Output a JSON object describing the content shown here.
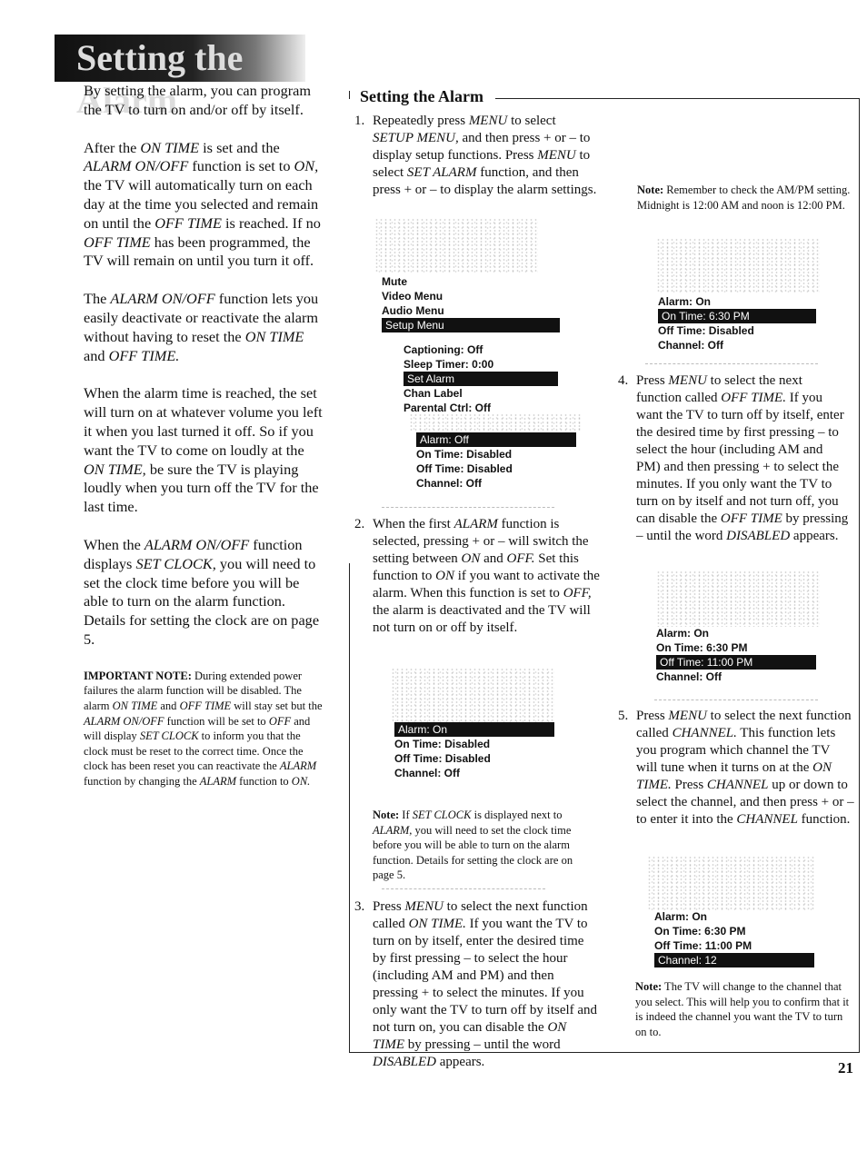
{
  "page_title": "Setting the Alarm",
  "left_column": [
    [
      {
        "t": "By setting the alarm, you can program the TV to turn on and/or off by itself."
      }
    ],
    [
      {
        "t": "After the "
      },
      {
        "t": "ON TIME",
        "i": true
      },
      {
        "t": " is set and the "
      },
      {
        "t": "ALARM ON/OFF",
        "i": true
      },
      {
        "t": " function is set to "
      },
      {
        "t": "ON,",
        "i": true
      },
      {
        "t": " the TV will automatically turn on each day at the time you selected and remain on until the "
      },
      {
        "t": "OFF TIME",
        "i": true
      },
      {
        "t": " is reached.  If no "
      },
      {
        "t": "OFF TIME",
        "i": true
      },
      {
        "t": " has been programmed, the TV will remain on until you turn it off."
      }
    ],
    [
      {
        "t": "The "
      },
      {
        "t": "ALARM ON/OFF",
        "i": true
      },
      {
        "t": " function lets you easily deactivate or reactivate the alarm without having to reset the "
      },
      {
        "t": "ON TIME",
        "i": true
      },
      {
        "t": " and "
      },
      {
        "t": "OFF TIME.",
        "i": true
      }
    ],
    [
      {
        "t": "When the alarm time is reached, the set will turn on at whatever volume you left it when you last turned it off.  So if you want the TV to come on loudly at the "
      },
      {
        "t": "ON TIME,",
        "i": true
      },
      {
        "t": " be sure the TV is playing loudly when you turn off the TV for the last time."
      }
    ],
    [
      {
        "t": "When the "
      },
      {
        "t": "ALARM ON/OFF",
        "i": true
      },
      {
        "t": " function displays "
      },
      {
        "t": "SET CLOCK,",
        "i": true
      },
      {
        "t": " you will need to set the clock time before you will be able to turn on the alarm function. Details for setting the clock are on page 5."
      }
    ]
  ],
  "important_note": [
    {
      "t": "IMPORTANT NOTE:",
      "b": true
    },
    {
      "t": " During extended power failures the alarm function will be disabled.  The alarm "
    },
    {
      "t": "ON TIME",
      "i": true
    },
    {
      "t": " and "
    },
    {
      "t": "OFF TIME",
      "i": true
    },
    {
      "t": " will stay set but the "
    },
    {
      "t": "ALARM ON/OFF",
      "i": true
    },
    {
      "t": " function will be set to "
    },
    {
      "t": "OFF",
      "i": true
    },
    {
      "t": " and will display "
    },
    {
      "t": "SET CLOCK",
      "i": true
    },
    {
      "t": " to inform you that the clock must be reset to the correct time.  Once the clock has been reset you can reactivate the "
    },
    {
      "t": "ALARM",
      "i": true
    },
    {
      "t": " function by changing the "
    },
    {
      "t": "ALARM",
      "i": true
    },
    {
      "t": " function to "
    },
    {
      "t": "ON.",
      "i": true
    }
  ],
  "section_title": "Setting the Alarm",
  "steps": [
    {
      "num": "1.",
      "text": [
        {
          "t": "Repeatedly press "
        },
        {
          "t": "MENU",
          "i": true
        },
        {
          "t": " to select "
        },
        {
          "t": "SETUP MENU,",
          "i": true
        },
        {
          "t": " and then press + or – to display setup functions.  Press "
        },
        {
          "t": "MENU",
          "i": true
        },
        {
          "t": " to select "
        },
        {
          "t": "SET ALARM",
          "i": true
        },
        {
          "t": " function, and then press + or – to display the alarm settings."
        }
      ]
    },
    {
      "num": "2.",
      "text": [
        {
          "t": "When the first "
        },
        {
          "t": "ALARM",
          "i": true
        },
        {
          "t": " function is selected, pressing + or – will switch the setting between "
        },
        {
          "t": "ON",
          "i": true
        },
        {
          "t": " and "
        },
        {
          "t": "OFF.",
          "i": true
        },
        {
          "t": "  Set this function to "
        },
        {
          "t": "ON",
          "i": true
        },
        {
          "t": " if you want to activate the alarm.  When this function is set to "
        },
        {
          "t": "OFF,",
          "i": true
        },
        {
          "t": " the alarm is deactivated and the TV will not turn on or off by itself."
        }
      ]
    },
    {
      "num": "3.",
      "text": [
        {
          "t": "Press "
        },
        {
          "t": "MENU",
          "i": true
        },
        {
          "t": " to select the next function called "
        },
        {
          "t": "ON TIME.",
          "i": true
        },
        {
          "t": "  If you want the TV to turn on by itself, enter the desired time by first pressing – to select the hour (including AM and PM) and then pressing + to select the minutes.  If you only want the TV to turn off by itself and not turn on, you can disable the "
        },
        {
          "t": "ON TIME",
          "i": true
        },
        {
          "t": " by pressing – until the word "
        },
        {
          "t": "DISABLED",
          "i": true
        },
        {
          "t": " appears."
        }
      ]
    },
    {
      "num": "4.",
      "text": [
        {
          "t": "Press "
        },
        {
          "t": "MENU",
          "i": true
        },
        {
          "t": " to select the next function called "
        },
        {
          "t": "OFF TIME.",
          "i": true
        },
        {
          "t": "  If you want the TV to turn off by itself, enter the desired time by first pressing – to select the hour (including AM and PM) and then pressing + to select the minutes.  If you only want the TV to turn on by itself and not turn off, you can disable the "
        },
        {
          "t": "OFF TIME",
          "i": true
        },
        {
          "t": " by pressing – until the word "
        },
        {
          "t": "DISABLED",
          "i": true
        },
        {
          "t": " appears."
        }
      ]
    },
    {
      "num": "5.",
      "text": [
        {
          "t": "Press "
        },
        {
          "t": "MENU",
          "i": true
        },
        {
          "t": " to select the next function called "
        },
        {
          "t": "CHANNEL.",
          "i": true
        },
        {
          "t": "  This function lets you program which channel the TV will tune when it turns on at the "
        },
        {
          "t": "ON TIME.",
          "i": true
        },
        {
          "t": "  Press "
        },
        {
          "t": "CHANNEL",
          "i": true
        },
        {
          "t": " up or down to select the channel, and then press + or – to enter it into the "
        },
        {
          "t": "CHANNEL",
          "i": true
        },
        {
          "t": " function."
        }
      ]
    }
  ],
  "note_set_clock": [
    {
      "t": "Note:",
      "b": true
    },
    {
      "t": "  If "
    },
    {
      "t": "SET CLOCK",
      "i": true
    },
    {
      "t": " is displayed next to "
    },
    {
      "t": "ALARM,",
      "i": true
    },
    {
      "t": " you will need to set the clock time before you will be able to turn on the alarm function.  Details for setting the clock are on page 5."
    }
  ],
  "note_ampm": [
    {
      "t": "Note:",
      "b": true
    },
    {
      "t": "  Remember to check the AM/PM setting.  Midnight is 12:00 AM and noon is 12:00 PM."
    }
  ],
  "note_channel": [
    {
      "t": "Note:",
      "b": true
    },
    {
      "t": "  The TV will change to the channel that you select.  This will help you to confirm that it is indeed the channel you want the TV to turn on to."
    }
  ],
  "screens": {
    "main_menu": {
      "items": [
        "Mute",
        "Video Menu",
        "Audio Menu",
        "Setup Menu"
      ],
      "selected": 3
    },
    "setup_menu": {
      "items": [
        "Captioning:  Off",
        "Sleep Timer:  0:00",
        "Set Alarm",
        "Chan Label",
        "Parental Ctrl:  Off"
      ],
      "selected": 2
    },
    "alarm_off": {
      "items": [
        "Alarm:  Off",
        "On Time:  Disabled",
        "Off Time:  Disabled",
        "Channel:  Off"
      ],
      "selected": 0
    },
    "alarm_on": {
      "items": [
        "Alarm:  On",
        "On Time:  Disabled",
        "Off Time:  Disabled",
        "Channel:  Off"
      ],
      "selected": 0
    },
    "on_time": {
      "items": [
        "Alarm:  On",
        "On Time:  6:30 PM",
        "Off Time:  Disabled",
        "Channel:  Off"
      ],
      "selected": 1
    },
    "off_time": {
      "items": [
        "Alarm:  On",
        "On Time:  6:30 PM",
        "Off Time:  11:00 PM",
        "Channel:  Off"
      ],
      "selected": 2
    },
    "channel": {
      "items": [
        "Alarm:  On",
        "On Time:  6:30 PM",
        "Off Time:  11:00 PM",
        "Channel:  12"
      ],
      "selected": 3
    }
  },
  "page_number": "21"
}
